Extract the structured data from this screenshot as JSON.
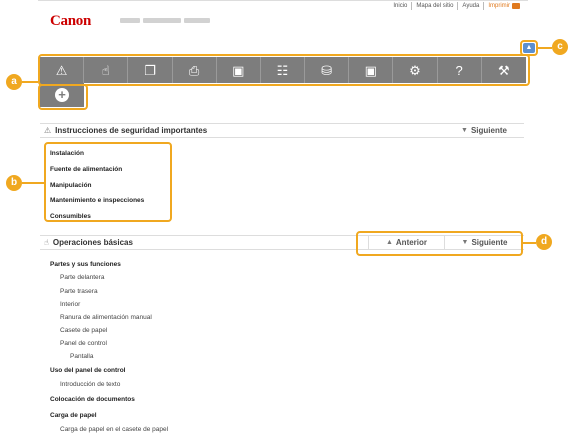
{
  "header": {
    "top_links": [
      "Inicio",
      "Mapa del sitio",
      "Ayuda"
    ],
    "print_label": "Imprimir",
    "logo": "Canon"
  },
  "nav": {
    "icons": [
      "warning-icon",
      "hand-icon",
      "copy-icon",
      "printer-icon",
      "scanner-icon",
      "network-icon",
      "lock-icon",
      "device-signal-icon",
      "gear-icon",
      "help-icon",
      "wrench-icon"
    ],
    "extra_icon": "plus-icon"
  },
  "callouts": {
    "a": "a",
    "b": "b",
    "c": "c",
    "d": "d"
  },
  "safety": {
    "title": "Instrucciones de seguridad importantes",
    "next": "Siguiente",
    "items": [
      "Instalación",
      "Fuente de alimentación",
      "Manipulación",
      "Mantenimiento e inspecciones",
      "Consumibles"
    ]
  },
  "basic": {
    "title": "Operaciones básicas",
    "prev": "Anterior",
    "next": "Siguiente",
    "items": [
      {
        "text": "Partes y sus funciones",
        "level": 0
      },
      {
        "text": "Parte delantera",
        "level": 1
      },
      {
        "text": "Parte trasera",
        "level": 1
      },
      {
        "text": "Interior",
        "level": 1
      },
      {
        "text": "Ranura de alimentación manual",
        "level": 1
      },
      {
        "text": "Casete de papel",
        "level": 1
      },
      {
        "text": "Panel de control",
        "level": 1
      },
      {
        "text": "Pantalla",
        "level": 2
      },
      {
        "text": "Uso del panel de control",
        "level": 0
      },
      {
        "text": "Introducción de texto",
        "level": 1
      },
      {
        "text": "Colocación de documentos",
        "level": 0
      },
      {
        "text": "Carga de papel",
        "level": 0
      },
      {
        "text": "Carga de papel en el casete de papel",
        "level": 1
      }
    ]
  }
}
